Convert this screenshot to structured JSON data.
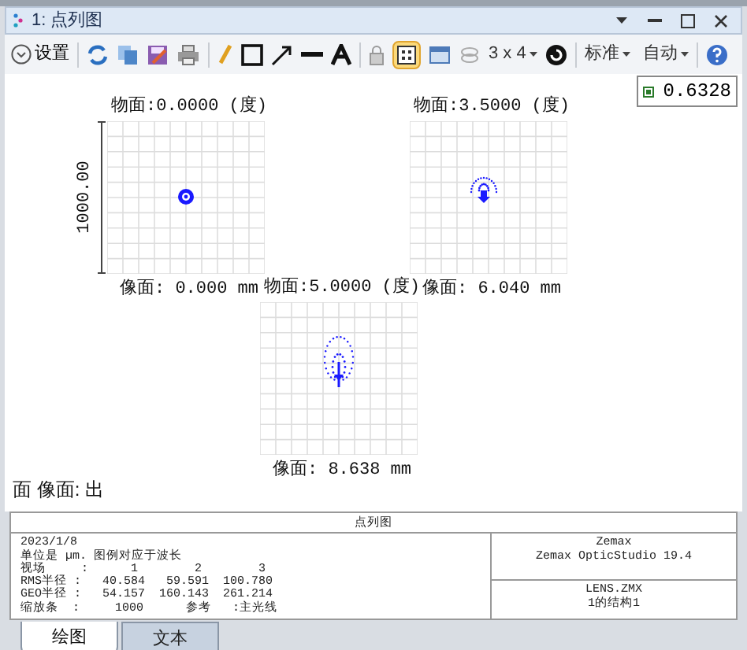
{
  "window": {
    "title": "1: 点列图"
  },
  "toolbar": {
    "settings_label": "设置",
    "layout_button": {
      "selected": true
    },
    "grid_dropdown": "3 x 4",
    "dropdowns": [
      "标准",
      "自动"
    ]
  },
  "legend": {
    "wavelength": "0.6328"
  },
  "plots": [
    {
      "object_label": "物面:0.0000 (度)",
      "image_label": "像面: 0.000 mm",
      "kind": "round",
      "scale_label": "1000.00"
    },
    {
      "object_label": "物面:3.5000 (度)",
      "image_label": "像面: 6.040 mm",
      "kind": "coma"
    },
    {
      "object_label": "物面:5.0000 (度)",
      "image_label": "像面: 8.638 mm",
      "kind": "long-coma"
    }
  ],
  "surface_label": "面 像面: 出",
  "info_table": {
    "title": "点列图",
    "lines": [
      "2023/1/8",
      "单位是 µm. 图例对应于波长",
      "视场     :      1        2        3",
      "RMS半径 :   40.584   59.591  100.780",
      "GEO半径 :   54.157  160.143  261.214",
      "缩放条  :     1000      参考   :主光线"
    ],
    "software": [
      "Zemax",
      "Zemax OpticStudio 19.4"
    ],
    "file": [
      "LENS.ZMX",
      "1的结构1"
    ]
  },
  "tabs": [
    {
      "label": "绘图",
      "selected": true
    },
    {
      "label": "文本",
      "selected": false
    }
  ]
}
